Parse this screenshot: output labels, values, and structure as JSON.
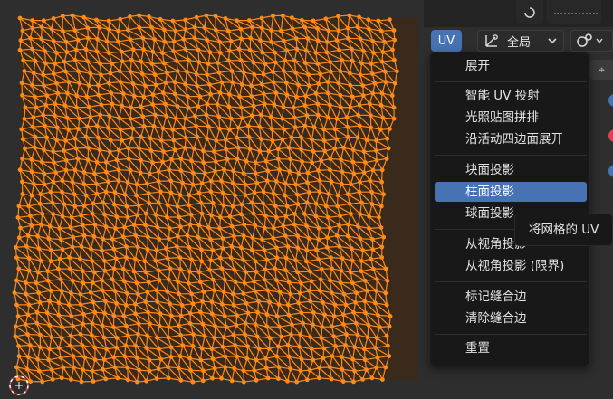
{
  "header": {
    "uv_menu_label": "UV",
    "pivot_label": "全局"
  },
  "uv_menu": {
    "items": [
      {
        "label": "展开",
        "active": false
      },
      {
        "label": "智能 UV 投射",
        "active": false
      },
      {
        "label": "光照贴图拼排",
        "active": false
      },
      {
        "label": "沿活动四边面展开",
        "active": false
      },
      {
        "label": "块面投影",
        "active": false
      },
      {
        "label": "柱面投影",
        "active": true
      },
      {
        "label": "球面投影",
        "active": false
      },
      {
        "label": "从视角投影",
        "active": false
      },
      {
        "label": "从视角投影 (限界)",
        "active": false
      },
      {
        "label": "标记缝合边",
        "active": false
      },
      {
        "label": "清除缝合边",
        "active": false
      },
      {
        "label": "重置",
        "active": false
      }
    ]
  },
  "tooltip": {
    "text": "将网格的 UV"
  },
  "colors": {
    "accent": "#4772b3",
    "mesh": "#ff8a1a",
    "gizmo_blue": "#4772b3",
    "gizmo_red": "#e04050"
  },
  "icons": {
    "pivot": "transform-pivot-icon",
    "dropdown": "chevron-down-icon",
    "snap": "snap-icon",
    "cursor": "2d-cursor-icon"
  }
}
